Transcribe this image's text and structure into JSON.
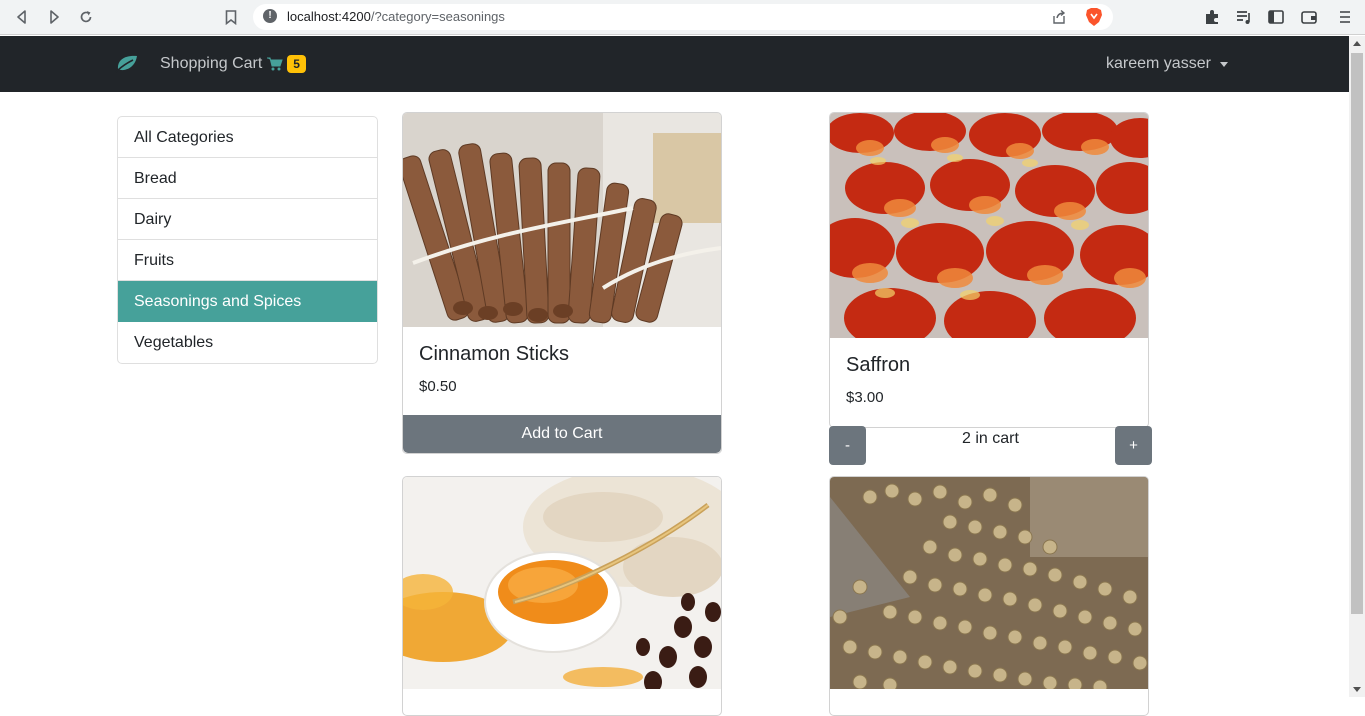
{
  "browser": {
    "url_host": "localhost:4200",
    "url_path": "/?category=seasonings"
  },
  "navbar": {
    "cart_label": "Shopping Cart",
    "cart_count": "5",
    "user_name": "kareem yasser"
  },
  "categories": {
    "items": [
      {
        "label": "All Categories"
      },
      {
        "label": "Bread"
      },
      {
        "label": "Dairy"
      },
      {
        "label": "Fruits"
      },
      {
        "label": "Seasonings and Spices",
        "active": true
      },
      {
        "label": "Vegetables"
      }
    ]
  },
  "products": [
    {
      "title": "Cinnamon Sticks",
      "price": "$0.50",
      "action": "Add to Cart"
    },
    {
      "title": "Saffron",
      "price": "$3.00",
      "minus": "-",
      "qty_text": "2 in cart",
      "plus": "+"
    }
  ],
  "colors": {
    "accent": "#46a19a",
    "navbar": "#212529",
    "badge": "#ffc107",
    "button": "#6c757d"
  }
}
